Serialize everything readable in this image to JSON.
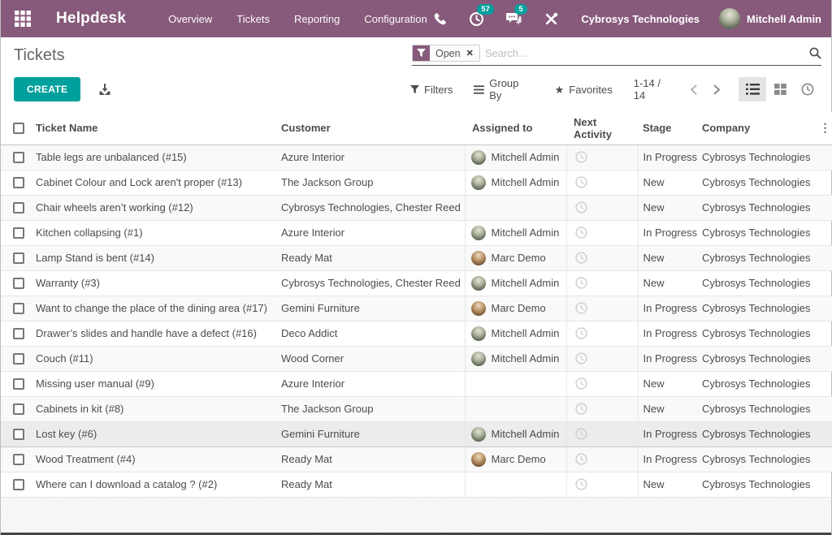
{
  "nav": {
    "app_name": "Helpdesk",
    "menus": [
      {
        "label": "Overview"
      },
      {
        "label": "Tickets"
      },
      {
        "label": "Reporting"
      },
      {
        "label": "Configuration"
      }
    ],
    "badges": {
      "activities": "57",
      "messages": "5"
    },
    "company": "Cybrosys Technologies",
    "user": "Mitchell Admin"
  },
  "control_panel": {
    "title": "Tickets",
    "filter_facet": "Open",
    "search_placeholder": "Search...",
    "create_label": "CREATE",
    "filters_label": "Filters",
    "groupby_label": "Group By",
    "favorites_label": "Favorites",
    "pager": "1-14 / 14"
  },
  "icons": {
    "star": "★",
    "close": "✕",
    "ellipsis_v": "⋮"
  },
  "colors": {
    "brand_purple": "#875A7B",
    "accent_teal": "#00A09D",
    "badge_teal": "#00A09D"
  },
  "table": {
    "columns": [
      "Ticket Name",
      "Customer",
      "Assigned to",
      "Next Activity",
      "Stage",
      "Company"
    ],
    "rows": [
      {
        "name": "Table legs are unbalanced (#15)",
        "customer": "Azure Interior",
        "assignee": "Mitchell Admin",
        "avatar": "mitchell",
        "stage": "In Progress",
        "company": "Cybrosys Technologies",
        "highlight": false
      },
      {
        "name": "Cabinet Colour and Lock aren't proper (#13)",
        "customer": "The Jackson Group",
        "assignee": "Mitchell Admin",
        "avatar": "mitchell",
        "stage": "New",
        "company": "Cybrosys Technologies",
        "highlight": false
      },
      {
        "name": "Chair wheels aren’t working (#12)",
        "customer": "Cybrosys Technologies, Chester Reed",
        "assignee": "",
        "avatar": "",
        "stage": "New",
        "company": "Cybrosys Technologies",
        "highlight": false
      },
      {
        "name": "Kitchen collapsing (#1)",
        "customer": "Azure Interior",
        "assignee": "Mitchell Admin",
        "avatar": "mitchell",
        "stage": "In Progress",
        "company": "Cybrosys Technologies",
        "highlight": false
      },
      {
        "name": "Lamp Stand is bent (#14)",
        "customer": "Ready Mat",
        "assignee": "Marc Demo",
        "avatar": "marc",
        "stage": "New",
        "company": "Cybrosys Technologies",
        "highlight": false
      },
      {
        "name": "Warranty (#3)",
        "customer": "Cybrosys Technologies, Chester Reed",
        "assignee": "Mitchell Admin",
        "avatar": "mitchell",
        "stage": "New",
        "company": "Cybrosys Technologies",
        "highlight": false
      },
      {
        "name": "Want to change the place of the dining area (#17)",
        "customer": "Gemini Furniture",
        "assignee": "Marc Demo",
        "avatar": "marc",
        "stage": "In Progress",
        "company": "Cybrosys Technologies",
        "highlight": false
      },
      {
        "name": "Drawer’s slides and handle have a defect (#16)",
        "customer": "Deco Addict",
        "assignee": "Mitchell Admin",
        "avatar": "mitchell",
        "stage": "In Progress",
        "company": "Cybrosys Technologies",
        "highlight": false
      },
      {
        "name": "Couch (#11)",
        "customer": "Wood Corner",
        "assignee": "Mitchell Admin",
        "avatar": "mitchell",
        "stage": "In Progress",
        "company": "Cybrosys Technologies",
        "highlight": false
      },
      {
        "name": "Missing user manual (#9)",
        "customer": "Azure Interior",
        "assignee": "",
        "avatar": "",
        "stage": "New",
        "company": "Cybrosys Technologies",
        "highlight": false
      },
      {
        "name": "Cabinets in kit (#8)",
        "customer": "The Jackson Group",
        "assignee": "",
        "avatar": "",
        "stage": "New",
        "company": "Cybrosys Technologies",
        "highlight": false
      },
      {
        "name": "Lost key (#6)",
        "customer": "Gemini Furniture",
        "assignee": "Mitchell Admin",
        "avatar": "mitchell",
        "stage": "In Progress",
        "company": "Cybrosys Technologies",
        "highlight": true
      },
      {
        "name": "Wood Treatment (#4)",
        "customer": "Ready Mat",
        "assignee": "Marc Demo",
        "avatar": "marc",
        "stage": "In Progress",
        "company": "Cybrosys Technologies",
        "highlight": false
      },
      {
        "name": "Where can I download a catalog ? (#2)",
        "customer": "Ready Mat",
        "assignee": "",
        "avatar": "",
        "stage": "New",
        "company": "Cybrosys Technologies",
        "highlight": false
      }
    ]
  }
}
